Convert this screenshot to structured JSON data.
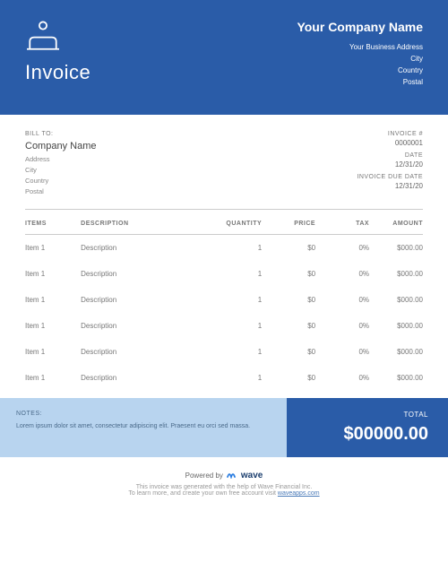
{
  "header": {
    "doc_title": "Invoice",
    "company_name": "Your Company Name",
    "address": "Your Business Address",
    "city": "City",
    "country": "Country",
    "postal": "Postal"
  },
  "bill_to": {
    "label": "BILL TO:",
    "company": "Company Name",
    "address": "Address",
    "city": "City",
    "country": "Country",
    "postal": "Postal"
  },
  "invoice_meta": {
    "number_label": "INVOICE #",
    "number": "0000001",
    "date_label": "DATE",
    "date": "12/31/20",
    "due_label": "INVOICE DUE DATE",
    "due": "12/31/20"
  },
  "columns": {
    "items": "ITEMS",
    "description": "DESCRIPTION",
    "quantity": "QUANTITY",
    "price": "PRICE",
    "tax": "TAX",
    "amount": "AMOUNT"
  },
  "rows": [
    {
      "item": "Item 1",
      "desc": "Description",
      "qty": "1",
      "price": "$0",
      "tax": "0%",
      "amount": "$000.00"
    },
    {
      "item": "Item 1",
      "desc": "Description",
      "qty": "1",
      "price": "$0",
      "tax": "0%",
      "amount": "$000.00"
    },
    {
      "item": "Item 1",
      "desc": "Description",
      "qty": "1",
      "price": "$0",
      "tax": "0%",
      "amount": "$000.00"
    },
    {
      "item": "Item 1",
      "desc": "Description",
      "qty": "1",
      "price": "$0",
      "tax": "0%",
      "amount": "$000.00"
    },
    {
      "item": "Item 1",
      "desc": "Description",
      "qty": "1",
      "price": "$0",
      "tax": "0%",
      "amount": "$000.00"
    },
    {
      "item": "Item 1",
      "desc": "Description",
      "qty": "1",
      "price": "$0",
      "tax": "0%",
      "amount": "$000.00"
    }
  ],
  "notes": {
    "label": "NOTES:",
    "text": "Lorem ipsum dolor sit amet, consectetur adipiscing elit. Praesent eu orci sed massa."
  },
  "total": {
    "label": "TOTAL",
    "amount": "$00000.00"
  },
  "footer": {
    "powered_by": "Powered by",
    "brand": "wave",
    "line1": "This invoice was generated with the help of Wave Financial Inc.",
    "line2_a": "To learn more, and create your own free account visit ",
    "link": "waveapps.com"
  }
}
